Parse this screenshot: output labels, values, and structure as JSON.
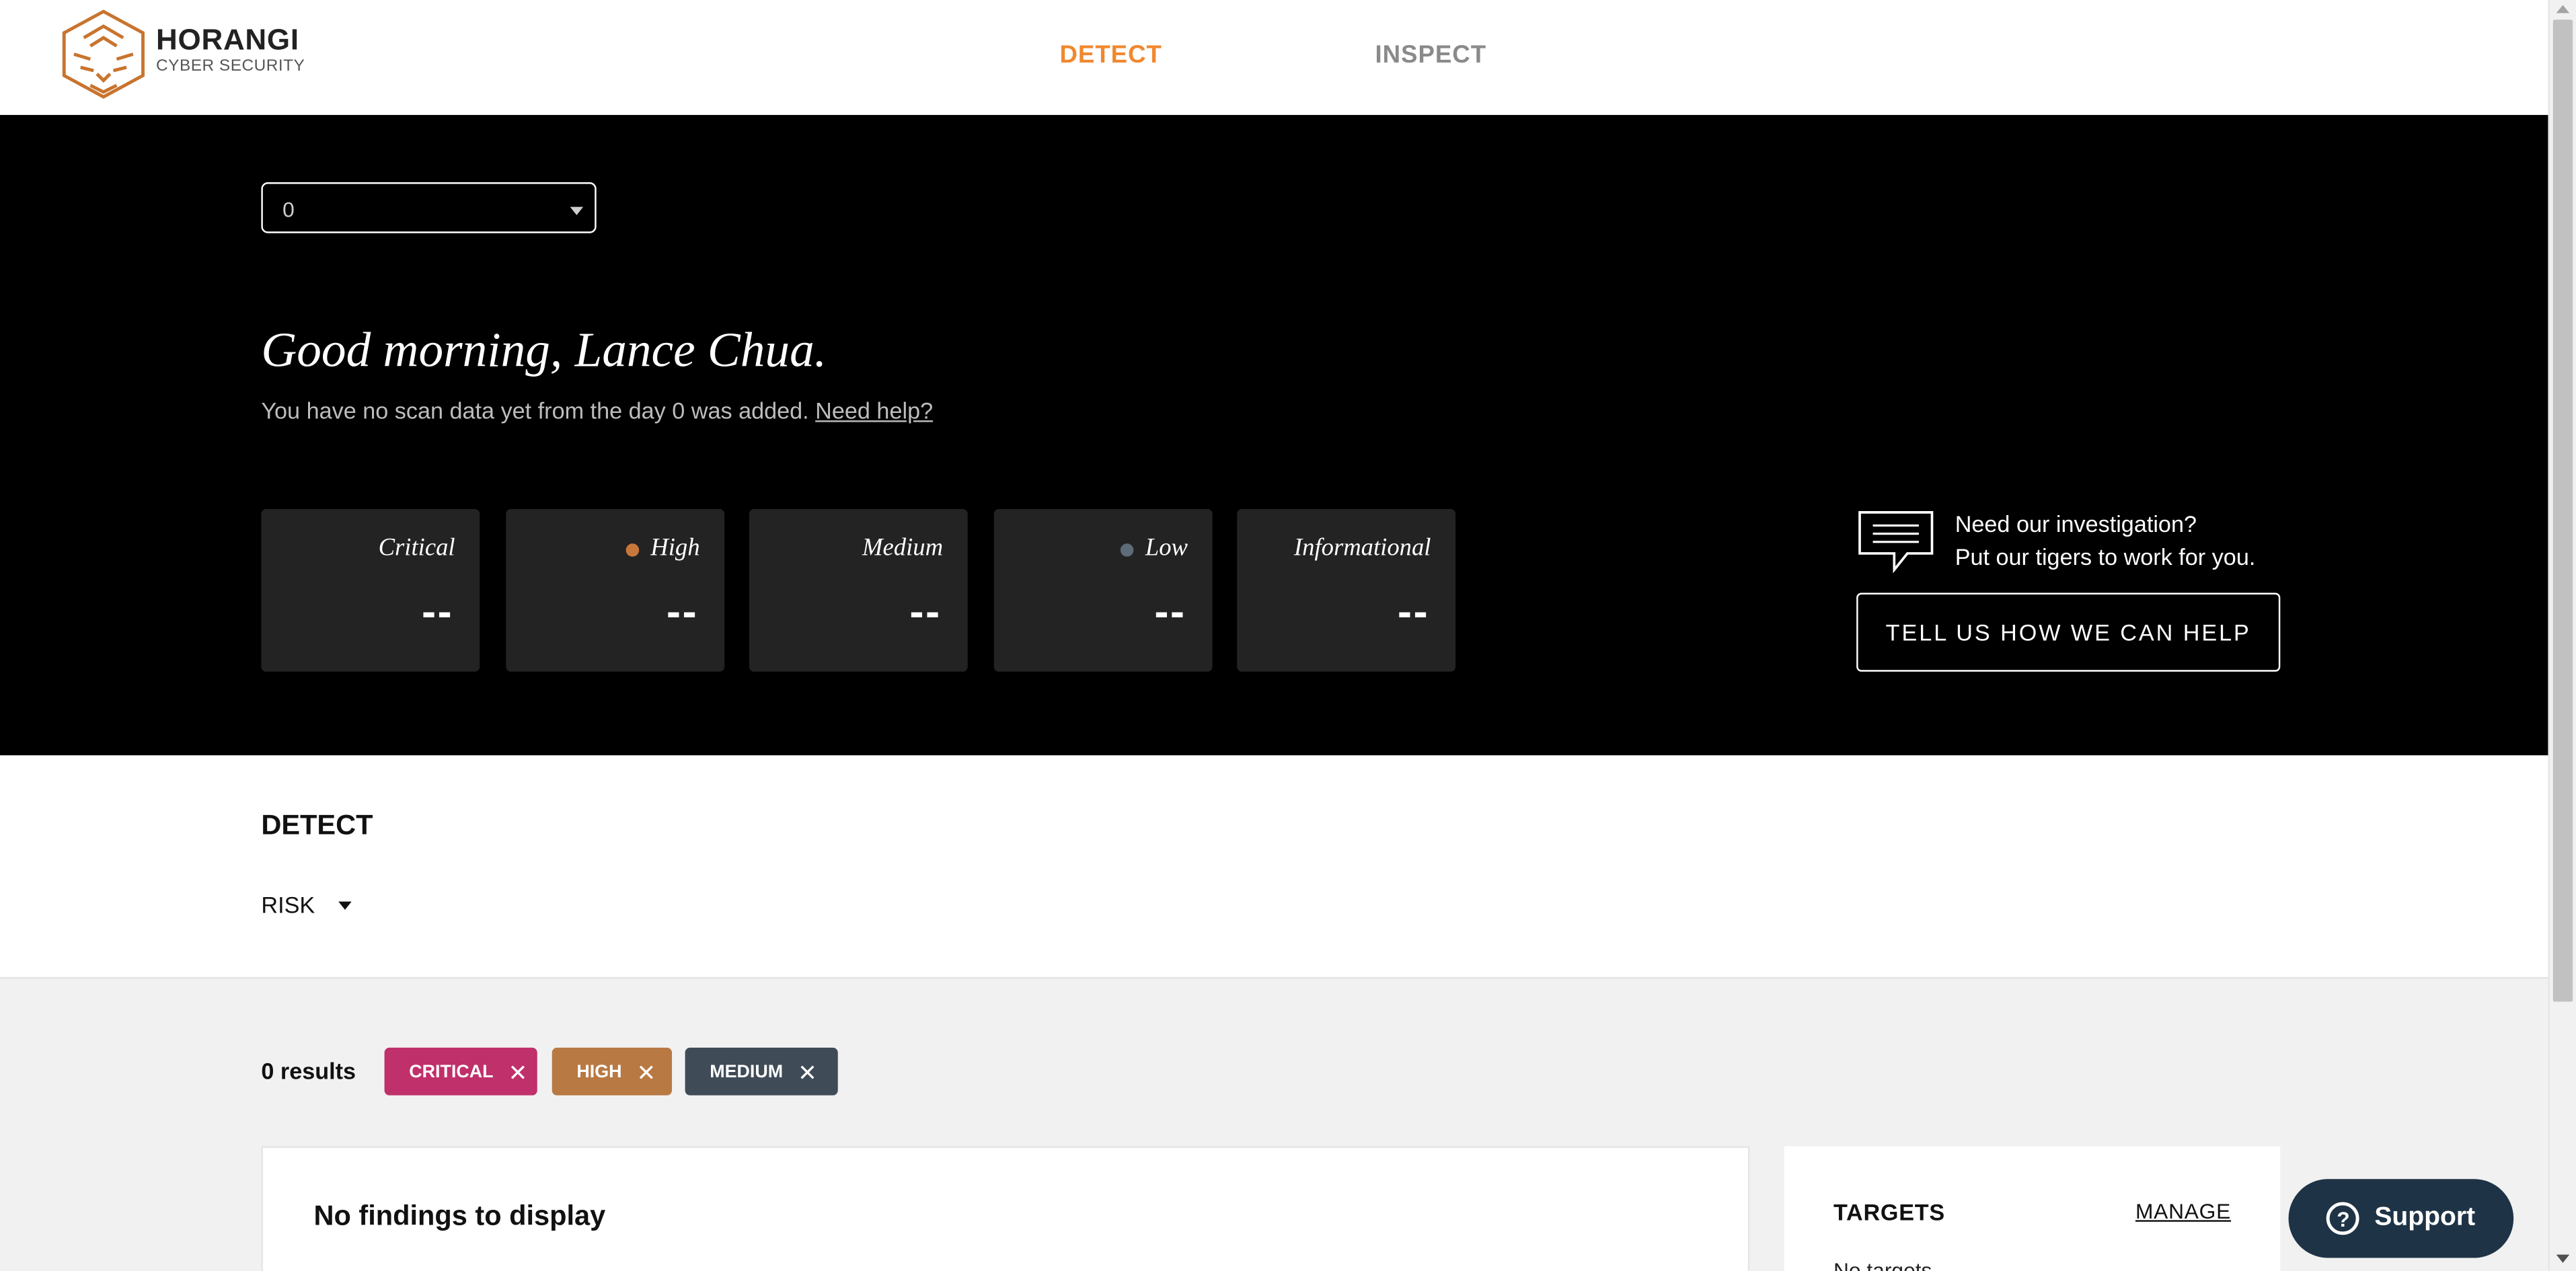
{
  "header": {
    "brand_name": "HORANGI",
    "brand_sub": "CYBER SECURITY",
    "nav": {
      "detect": "DETECT",
      "inspect": "INSPECT"
    },
    "active_nav": "DETECT",
    "accent_color": "#f0882f"
  },
  "hero": {
    "target_select_value": "0",
    "greeting": "Good morning, Lance Chua.",
    "subline": "You have no scan data yet from the day 0 was added.",
    "help_link": "Need help?",
    "severity_cards": [
      {
        "label": "Critical",
        "value": "--",
        "dot_color": null
      },
      {
        "label": "High",
        "value": "--",
        "dot_color": "#c8773a"
      },
      {
        "label": "Medium",
        "value": "--",
        "dot_color": null
      },
      {
        "label": "Low",
        "value": "--",
        "dot_color": "#5e6b78"
      },
      {
        "label": "Informational",
        "value": "--",
        "dot_color": null
      }
    ],
    "promo_line1": "Need our investigation?",
    "promo_line2": "Put our tigers to work for you.",
    "promo_button": "TELL US HOW WE CAN HELP"
  },
  "detect": {
    "title": "DETECT",
    "sort_label": "RISK"
  },
  "results": {
    "count_label": "0 results",
    "filters": [
      {
        "label": "CRITICAL",
        "color": "#c0306a"
      },
      {
        "label": "HIGH",
        "color": "#b97943"
      },
      {
        "label": "MEDIUM",
        "color": "#3f4b57"
      }
    ],
    "findings_empty": "No findings to display",
    "targets_title": "TARGETS",
    "manage_link": "MANAGE",
    "targets_empty": "No targets"
  },
  "support": {
    "label": "Support"
  }
}
